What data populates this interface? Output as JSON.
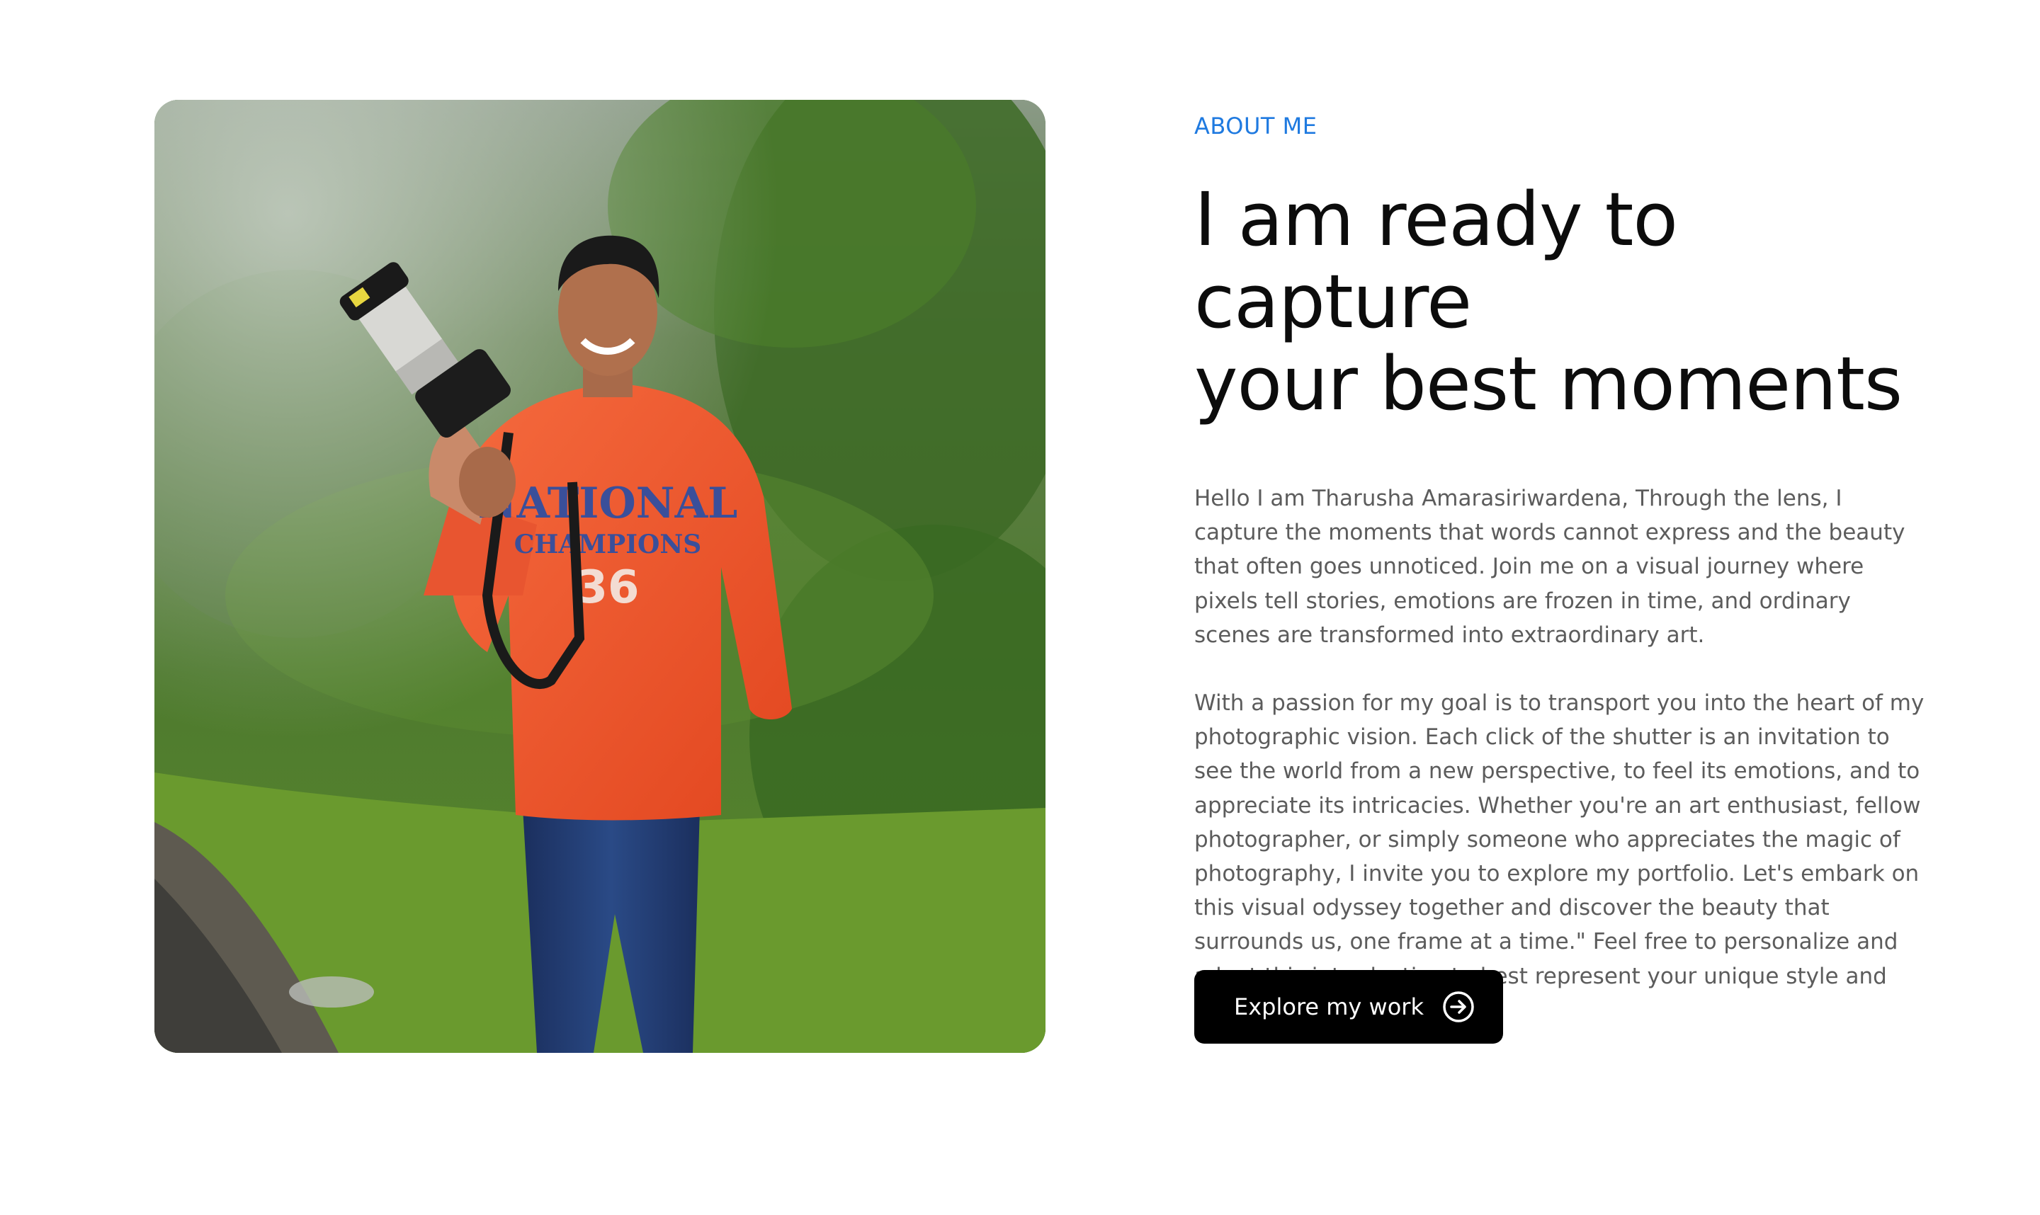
{
  "about": {
    "eyebrow": "ABOUT ME",
    "headline_line1": "I am ready to capture",
    "headline_line2": "your best moments",
    "paragraph1": "Hello I am Tharusha Amarasiriwardena, Through the lens, I capture the moments that words cannot express and the beauty that often goes unnoticed. Join me on a visual journey where pixels tell stories, emotions are frozen in time, and ordinary scenes are transformed into extraordinary art.",
    "paragraph2": "With a passion for my goal is to transport you into the heart of my photographic vision. Each click of the shutter is an invitation to see the world from a new perspective, to feel its emotions, and to appreciate its intricacies. Whether you're an art enthusiast, fellow photographer, or simply someone who appreciates the magic of photography, I invite you to explore my portfolio. Let's embark on this visual odyssey together and discover the beauty that surrounds us, one frame at a time.\" Feel free to personalize and adapt this introduction to best represent your unique style and approach to photography.",
    "cta_label": "Explore my work",
    "cta_icon": "arrow-right-circle-icon"
  },
  "photo": {
    "hoodie_text_line1": "NATIONAL",
    "hoodie_text_line2": "CHAMPIONS",
    "hoodie_number": "36"
  },
  "colors": {
    "accent": "#1f7ae0",
    "button_bg": "#000000",
    "button_text": "#ffffff",
    "hoodie": "#f0552e"
  }
}
